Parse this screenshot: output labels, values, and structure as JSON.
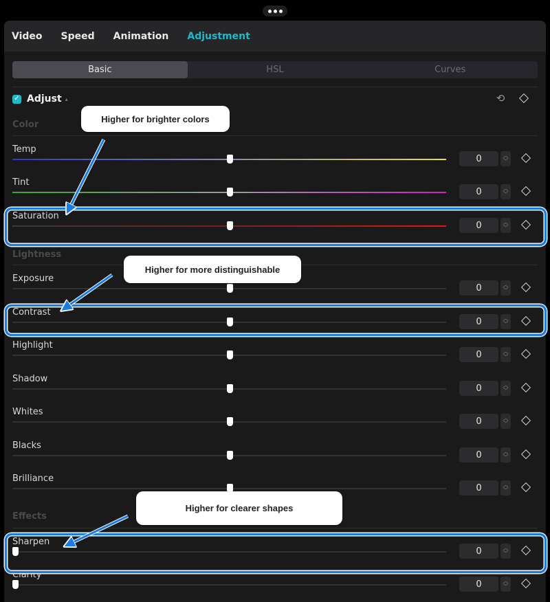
{
  "handle_icon": "more-horizontal-icon",
  "tabs": [
    {
      "label": "Video",
      "active": false
    },
    {
      "label": "Speed",
      "active": false
    },
    {
      "label": "Animation",
      "active": false
    },
    {
      "label": "Adjustment",
      "active": true
    }
  ],
  "subtabs": [
    {
      "label": "Basic",
      "active": true
    },
    {
      "label": "HSL",
      "active": false
    },
    {
      "label": "Curves",
      "active": false
    }
  ],
  "adjust": {
    "title": "Adjust",
    "checked": true,
    "caret": "▴",
    "reset_icon": "reset-icon",
    "keyframe_icon": "keyframe-diamond-icon"
  },
  "sections": {
    "color": "Color",
    "lightness": "Lightness",
    "effects": "Effects"
  },
  "sliders": [
    {
      "label": "Temp",
      "value": "0",
      "position": 0.5,
      "track": "gradient-blue-yellow"
    },
    {
      "label": "Tint",
      "value": "0",
      "position": 0.5,
      "track": "gradient-green-magenta"
    },
    {
      "label": "Saturation",
      "value": "0",
      "position": 0.5,
      "track": "gradient-gray-red"
    },
    {
      "label": "Exposure",
      "value": "0",
      "position": 0.5
    },
    {
      "label": "Contrast",
      "value": "0",
      "position": 0.5
    },
    {
      "label": "Highlight",
      "value": "0",
      "position": 0.5
    },
    {
      "label": "Shadow",
      "value": "0",
      "position": 0.5
    },
    {
      "label": "Whites",
      "value": "0",
      "position": 0.5
    },
    {
      "label": "Blacks",
      "value": "0",
      "position": 0.5
    },
    {
      "label": "Brilliance",
      "value": "0",
      "position": 0.5
    },
    {
      "label": "Sharpen",
      "value": "0",
      "position": 0.0
    },
    {
      "label": "Clarity",
      "value": "0",
      "position": 0.0
    }
  ],
  "callouts": [
    {
      "text": "Higher for brighter colors",
      "target": "Saturation"
    },
    {
      "text": "Higher for more distinguishable",
      "target": "Contrast"
    },
    {
      "text": "Higher for clearer shapes",
      "target": "Sharpen"
    }
  ],
  "colors": {
    "accent": "#22b8c6",
    "highlight_border": "#1a7be0",
    "panel_bg": "#1a1a1a"
  }
}
